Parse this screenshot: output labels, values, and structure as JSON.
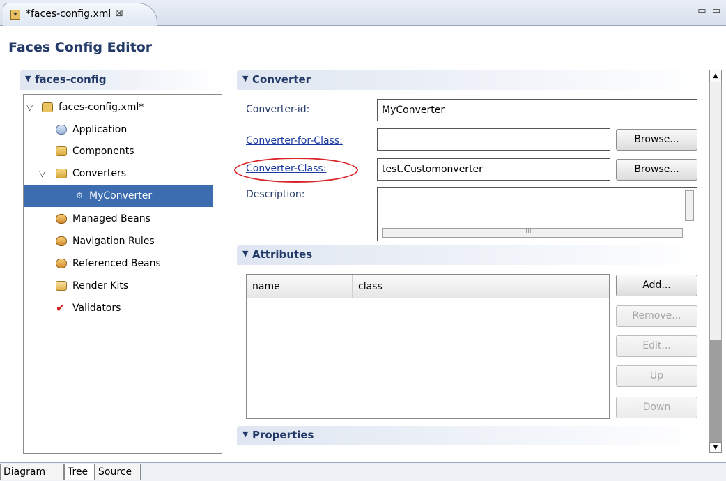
{
  "editor_tab": {
    "label": "*faces-config.xml",
    "close_glyph": "⊠"
  },
  "window_controls": {
    "glyph": "▭ ▭"
  },
  "page_title": "Faces Config Editor",
  "left_section": {
    "title": "faces-config",
    "tree": {
      "root": "faces-config.xml*",
      "items": [
        {
          "label": "Application",
          "icon": "application-icon"
        },
        {
          "label": "Components",
          "icon": "folder-icon"
        },
        {
          "label": "Converters",
          "icon": "converters-folder-icon"
        },
        {
          "label": "MyConverter",
          "icon": "converter-icon",
          "selected": true
        },
        {
          "label": "Managed Beans",
          "icon": "beans-icon"
        },
        {
          "label": "Navigation Rules",
          "icon": "navigation-icon"
        },
        {
          "label": "Referenced Beans",
          "icon": "beans-icon"
        },
        {
          "label": "Render Kits",
          "icon": "render-kit-icon"
        },
        {
          "label": "Validators",
          "icon": "checkmark-icon"
        }
      ]
    }
  },
  "converter_section": {
    "title": "Converter",
    "fields": {
      "converter_id": {
        "label": "Converter-id:",
        "value": "MyConverter"
      },
      "converter_for_class": {
        "label": "Converter-for-Class:",
        "value": ""
      },
      "converter_class": {
        "label": "Converter-Class:",
        "value": "test.Customonverter"
      },
      "description": {
        "label": "Description:",
        "value": ""
      }
    },
    "browse_label": "Browse...",
    "scroll_mid_glyph": "III"
  },
  "attributes_section": {
    "title": "Attributes",
    "columns": [
      "name",
      "class"
    ],
    "buttons": {
      "add": "Add...",
      "remove": "Remove...",
      "edit": "Edit...",
      "up": "Up",
      "down": "Down"
    }
  },
  "properties_section": {
    "title": "Properties"
  },
  "bottom_tabs": [
    "Diagram",
    "Tree",
    "Source"
  ],
  "colors": {
    "accent": "#233a68",
    "selection": "#3b6db0",
    "link": "#1a3aa0",
    "highlight_ellipse": "#d9262a"
  }
}
